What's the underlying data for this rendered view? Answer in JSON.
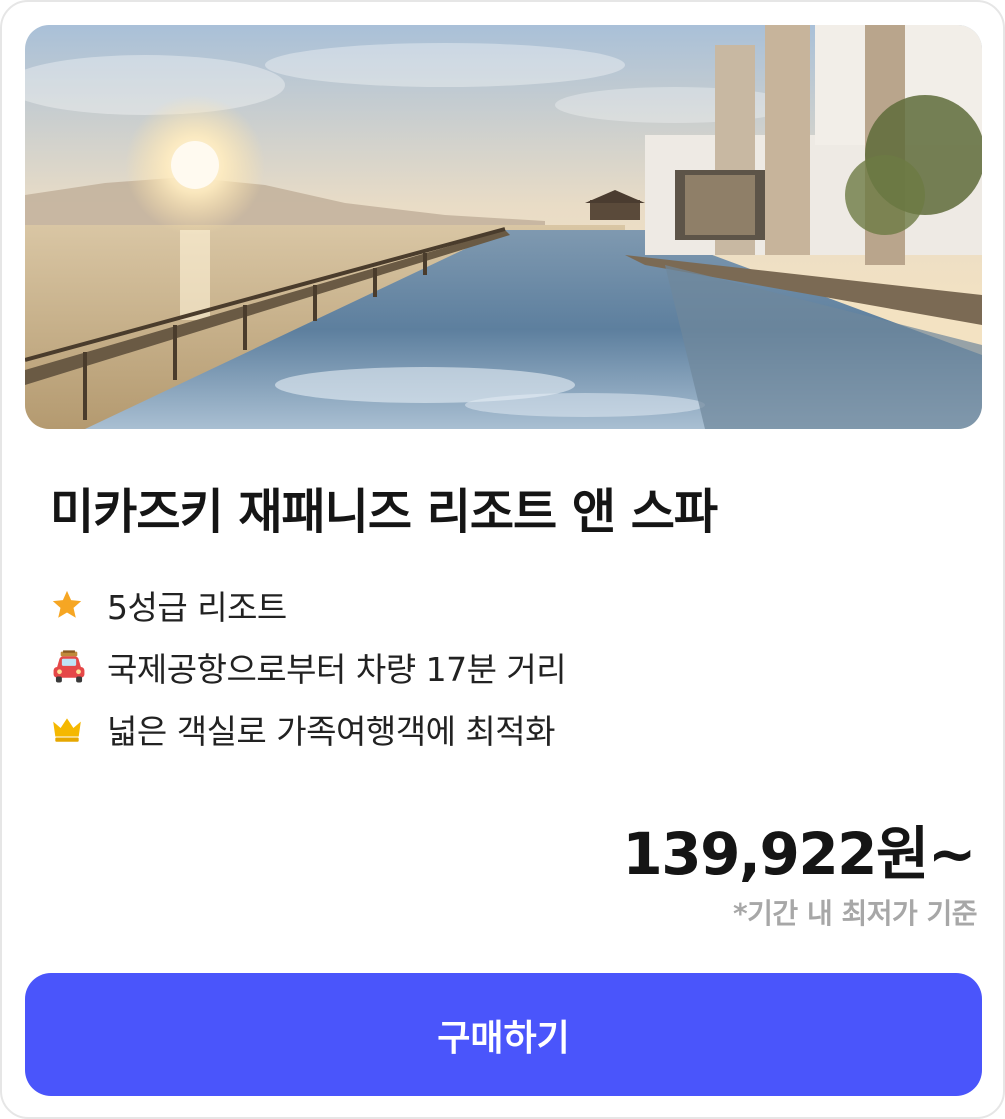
{
  "product": {
    "title": "미카즈키 재패니즈 리조트 앤 스파",
    "features": [
      {
        "icon": "star-icon",
        "text": "5성급 리조트"
      },
      {
        "icon": "car-icon",
        "text": "국제공항으로부터 차량 17분 거리"
      },
      {
        "icon": "crown-icon",
        "text": "넓은 객실로 가족여행객에 최적화"
      }
    ],
    "price": "139,922원~",
    "price_note": "*기간 내 최저가 기준",
    "buy_label": "구매하기"
  },
  "colors": {
    "accent": "#4a55fb",
    "star": "#f6a623",
    "crown": "#f5b800",
    "car": "#e54848"
  }
}
